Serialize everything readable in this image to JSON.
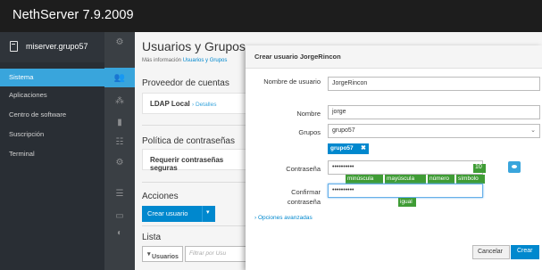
{
  "app": {
    "title": "NethServer 7.9.2009"
  },
  "sidebar": {
    "host": "miserver.grupo57",
    "items": [
      {
        "label": "Sistema",
        "active": true
      },
      {
        "label": "Aplicaciones",
        "active": false
      },
      {
        "label": "Centro de software",
        "active": false
      },
      {
        "label": "Suscripción",
        "active": false
      },
      {
        "label": "Terminal",
        "active": false
      }
    ]
  },
  "icons": [
    "settings-icon",
    "users-icon",
    "network-icon",
    "storage-icon",
    "services-icon",
    "certificates-icon",
    "logs-icon",
    "backup-icon",
    "terminal-icon"
  ],
  "page": {
    "title": "Usuarios y Grupos",
    "info_prefix": "Más información",
    "info_link": "Usuarios y Grupos",
    "provider_title": "Proveedor de cuentas",
    "provider_name": "LDAP Local",
    "provider_details": "Detalles",
    "policy_title": "Política de contraseñas",
    "policy_value": "Requerir contraseñas seguras",
    "actions_title": "Acciones",
    "create_user": "Crear usuario",
    "list_title": "Lista",
    "users_select": "Usuarios",
    "filter_placeholder": "Filtrar por Usu"
  },
  "modal": {
    "title": "Crear usuario JorgeRincon",
    "username_label": "Nombre de usuario",
    "username_value": "JorgeRincon",
    "name_label": "Nombre",
    "name_value": "jorge",
    "groups_label": "Grupos",
    "groups_value": "grupo57",
    "group_tag": "grupo57",
    "password_label": "Contraseña",
    "password_value": "••••••••••",
    "password_length": "10",
    "badges": [
      "minúscula",
      "mayúscula",
      "número",
      "símbolo"
    ],
    "confirm_label": "Confirmar contraseña",
    "confirm_value": "••••••••••",
    "confirm_badge": "igual",
    "advanced": "Opciones avanzadas",
    "cancel": "Cancelar",
    "create": "Crear"
  },
  "colors": {
    "accent": "#39a5dc",
    "primary": "#0088ce",
    "success": "#3f9c35",
    "topbar": "#1d1d1d"
  }
}
